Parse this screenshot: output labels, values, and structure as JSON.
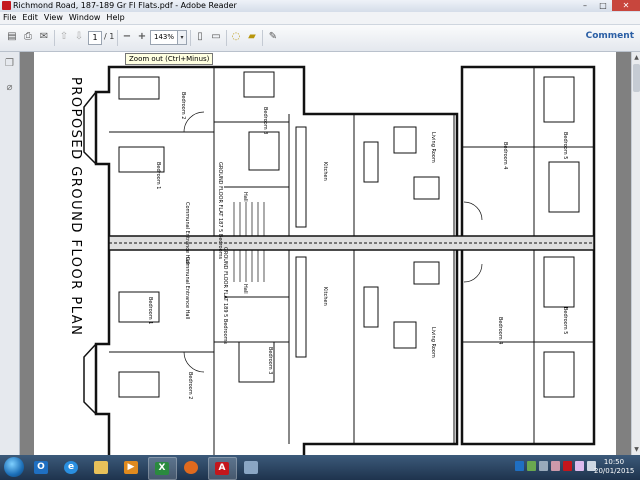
{
  "window": {
    "title": "Richmond Road, 187-189 Gr Fl Flats.pdf - Adobe Reader",
    "controls": {
      "minimize": "–",
      "maximize": "□",
      "close": "✕"
    }
  },
  "menu": [
    "File",
    "Edit",
    "View",
    "Window",
    "Help"
  ],
  "toolbar": {
    "page_current": "1",
    "page_total": "/ 1",
    "zoom": "143%",
    "zoom_dropdown_arrow": "▾",
    "comment_label": "Comment",
    "tooltip": "Zoom out (Ctrl+Minus)",
    "zoom_out_symbol": "−",
    "zoom_in_symbol": "+"
  },
  "document": {
    "plan_title": "PROPOSED GROUND FLOOR PLAN",
    "rooms_left_flat": [
      "Bedroom 2",
      "Bedroom 1",
      "Bedroom 3",
      "Kitchen",
      "Living Room",
      "Bedroom 4",
      "Bedroom 5"
    ],
    "rooms_right_flat": [
      "Bedroom 1",
      "Bedroom 2",
      "Bedroom 3",
      "Kitchen",
      "Living Room",
      "Bedroom 4",
      "Bedroom 5"
    ],
    "flat_labels": [
      "GROUND FLOOR FLAT 187 5 Bedrooms",
      "GROUND FLOOR FLAT 189 5 Bedrooms"
    ],
    "hall_labels": [
      "Communal Entrance Hall",
      "Communal Entrance Hall",
      "Hall",
      "Hall"
    ]
  },
  "taskbar": {
    "clock_time": "10:50",
    "clock_date": "20/01/2015",
    "apps": [
      "outlook",
      "internet-explorer",
      "file-explorer",
      "media-player",
      "excel",
      "firefox",
      "adobe-reader",
      "paint"
    ]
  },
  "colors": {
    "accent": "#2b5fa5",
    "reader_red": "#c4161c",
    "taskbar": "#1e334d"
  }
}
